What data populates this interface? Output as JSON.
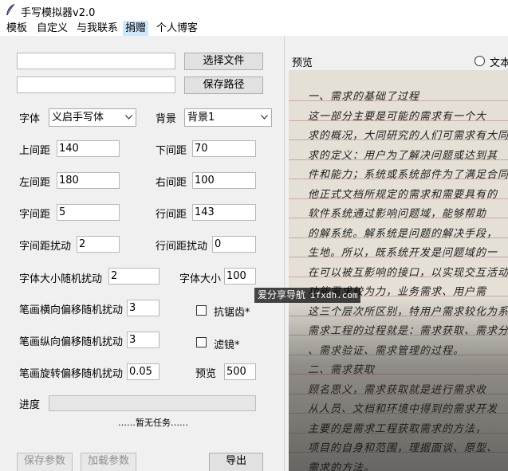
{
  "window": {
    "title": "手写模拟器v2.0",
    "icon": "feather-icon"
  },
  "menu": {
    "items": [
      "模板",
      "自定义",
      "与我联系",
      "捐赠",
      "个人博客"
    ],
    "active_index": 3
  },
  "files": {
    "text_file_value": "",
    "choose_file_label": "选择文件",
    "save_path_value": "",
    "save_path_label": "保存路径"
  },
  "params": {
    "font_label": "字体",
    "font_value": "义启手写体",
    "background_label": "背景",
    "background_value": "背景1",
    "top_margin_label": "上间距",
    "top_margin_value": "140",
    "bottom_margin_label": "下间距",
    "bottom_margin_value": "70",
    "left_margin_label": "左间距",
    "left_margin_value": "180",
    "right_margin_label": "右间距",
    "right_margin_value": "100",
    "char_spacing_label": "字间距",
    "char_spacing_value": "5",
    "line_spacing_label": "行间距",
    "line_spacing_value": "143",
    "char_spacing_jitter_label": "字间距扰动",
    "char_spacing_jitter_value": "2",
    "line_spacing_jitter_label": "行间距扰动",
    "line_spacing_jitter_value": "0",
    "font_size_jitter_label": "字体大小随机扰动",
    "font_size_jitter_value": "2",
    "font_size_label": "字体大小",
    "font_size_value": "100",
    "stroke_h_offset_label": "笔画横向偏移随机扰动",
    "stroke_h_offset_value": "3",
    "stroke_v_offset_label": "笔画纵向偏移随机扰动",
    "stroke_v_offset_value": "3",
    "stroke_rot_offset_label": "笔画旋转偏移随机扰动",
    "stroke_rot_offset_value": "0.05",
    "antialias_label": "抗锯齿*",
    "antialias_checked": false,
    "filter_label": "滤镜*",
    "filter_checked": false,
    "preview_label": "预览",
    "preview_value": "500"
  },
  "progress": {
    "label": "进度",
    "value": 0,
    "status_text": "……暂无任务……"
  },
  "actions": {
    "save_params_label": "保存参数",
    "load_params_label": "加载参数",
    "export_label": "导出"
  },
  "preview_panel": {
    "label": "预览",
    "radio_label": "文本",
    "handwriting_lines": [
      "一、需求的基础了过程",
      "  这一部分主要是可能的需求有一个大",
      "求的概况，大同研究的人们可需求有大同",
      "求的定义：用户为了解决问题或达到其",
      "件和能力；系统或系统部件为了满足合同",
      "他正式文档所规定的需求和需要具有的",
      "  软件系统通过影响问题域，能够帮助",
      "的解系统。解系统是问题的解决手段，",
      "生地。所以，既系统开发是问题域的一",
      "在可以被互影响的接口，以实现交互活动",
      "  功能需求较为力，业务需求、用户需",
      "这三个层次所区别，特用户需求较化为系统",
      "需求工程的过程就是：需求获取、需求分",
      "、需求验证、需求管理的过程。",
      "二、需求获取",
      "  顾名思义，需求获取就是进行需求收",
      "从人员、文档和环境中得到的需求开发",
      "  主要的是需求工程获取需求的方法，",
      "项目的自身和范围，理据面谈、原型、",
      "需求的方法。"
    ]
  },
  "watermark": {
    "text": "爱分享导航",
    "url": "ifxdh.com"
  },
  "colors": {
    "window_bg": "#f0f0f0",
    "menu_active_bg": "#cce8ff",
    "paper_bg": "#e5e0d6",
    "paper_line": "#c9a9a5"
  }
}
